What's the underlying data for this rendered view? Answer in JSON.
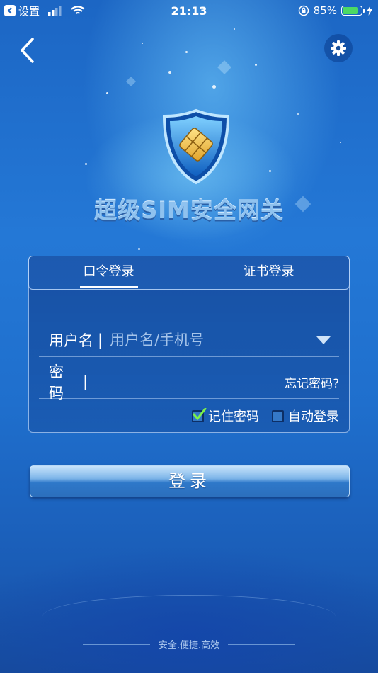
{
  "status_bar": {
    "back_app": "设置",
    "time": "21:13",
    "battery_percent": "85%",
    "battery_level": 0.85
  },
  "app": {
    "title": "超级SIM安全网关"
  },
  "tabs": [
    {
      "label": "口令登录",
      "active": true
    },
    {
      "label": "证书登录",
      "active": false
    }
  ],
  "form": {
    "username_label": "用户名",
    "username_placeholder": "用户名/手机号",
    "password_label": "密　码",
    "forgot_label": "忘记密码?",
    "separator": "|",
    "remember_label": "记住密码",
    "remember_checked": true,
    "auto_login_label": "自动登录",
    "auto_login_checked": false
  },
  "login_button": "登录",
  "footer": "安全.便捷.高效",
  "colors": {
    "background": "#2478d6",
    "check": "#7cf04a"
  }
}
